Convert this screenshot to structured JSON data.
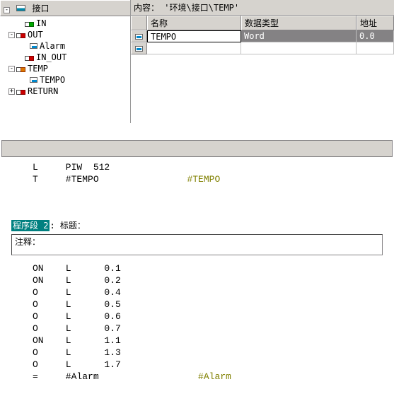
{
  "tree": {
    "header_icon": "interface-icon",
    "header_label": "接口",
    "nodes": {
      "in": {
        "toggle": "",
        "label": "IN"
      },
      "out": {
        "toggle": "-",
        "label": "OUT"
      },
      "alarm": {
        "label": "Alarm"
      },
      "inout": {
        "toggle": "",
        "label": "IN_OUT"
      },
      "temp": {
        "toggle": "-",
        "label": "TEMP"
      },
      "tempo": {
        "label": "TEMPO"
      },
      "return": {
        "toggle": "+",
        "label": "RETURN"
      }
    }
  },
  "content": {
    "path_label": "内容：",
    "path_value": "'环境\\接口\\TEMP'",
    "columns": {
      "name": "名称",
      "type": "数据类型",
      "addr": "地址"
    },
    "rows": [
      {
        "name": "TEMPO",
        "type": "Word",
        "addr": "0.0",
        "selected": true,
        "icon": "var-icon"
      },
      {
        "name": "",
        "type": "",
        "addr": "",
        "selected": false,
        "icon": "var-icon"
      }
    ]
  },
  "segment1": {
    "code": [
      {
        "op": "L",
        "arg": "PIW  512",
        "comment": ""
      },
      {
        "op": "T",
        "arg": "#TEMPO",
        "comment": "#TEMPO"
      }
    ]
  },
  "segment2": {
    "title_prefix": "程序段 2",
    "title_suffix": ": 标题：",
    "comment_label": "注释：",
    "code": [
      {
        "op": "ON",
        "a": "L",
        "b": "0.1"
      },
      {
        "op": "ON",
        "a": "L",
        "b": "0.2"
      },
      {
        "op": "O",
        "a": "L",
        "b": "0.4"
      },
      {
        "op": "O",
        "a": "L",
        "b": "0.5"
      },
      {
        "op": "O",
        "a": "L",
        "b": "0.6"
      },
      {
        "op": "O",
        "a": "L",
        "b": "0.7"
      },
      {
        "op": "ON",
        "a": "L",
        "b": "1.1"
      },
      {
        "op": "O",
        "a": "L",
        "b": "1.3"
      },
      {
        "op": "O",
        "a": "L",
        "b": "1.7"
      },
      {
        "op": "=",
        "a": "#Alarm",
        "b": "",
        "comment": "#Alarm"
      }
    ]
  }
}
